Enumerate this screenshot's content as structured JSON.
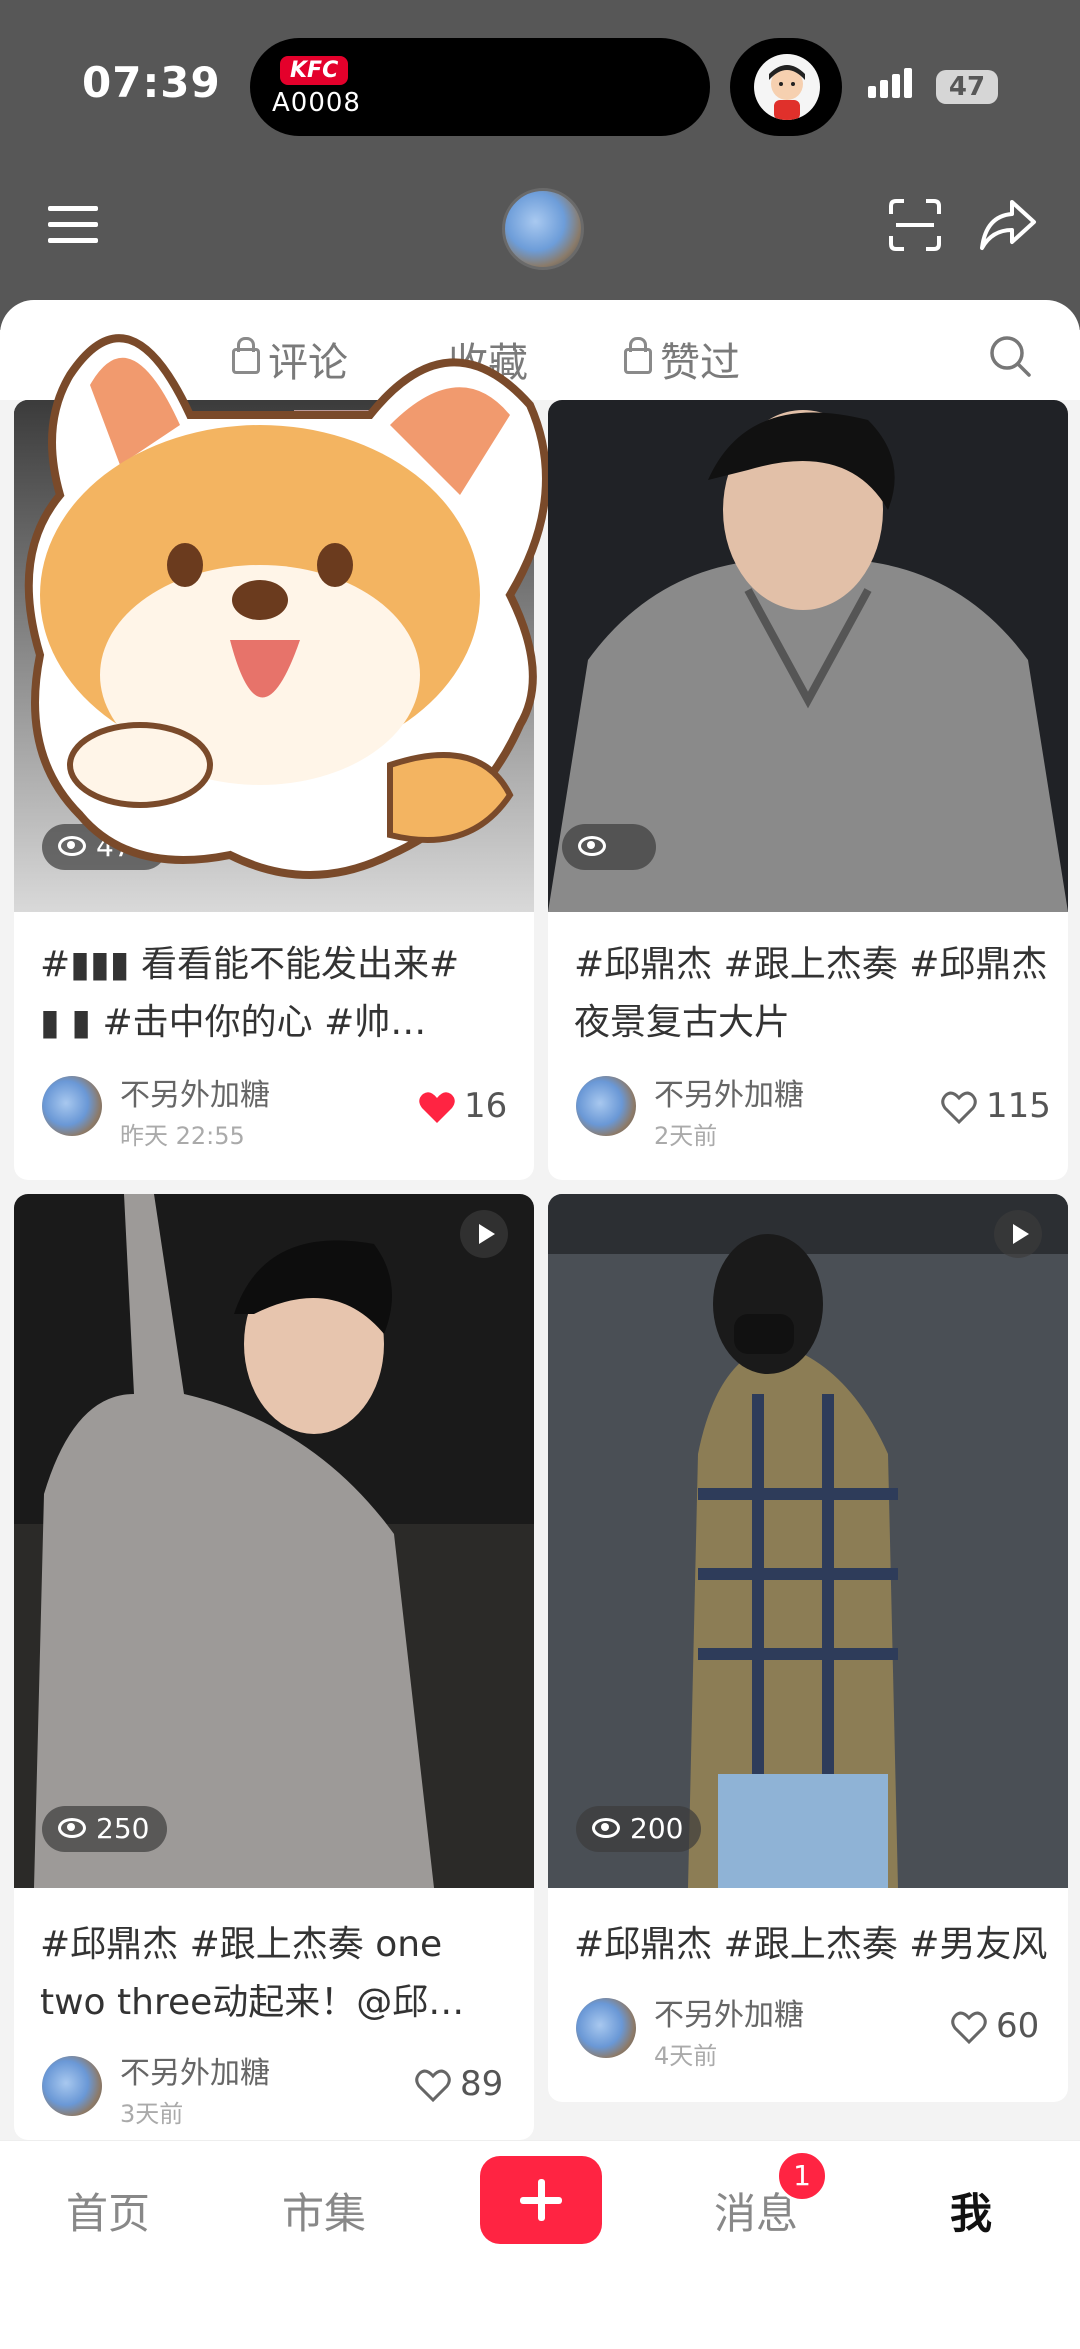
{
  "status_bar": {
    "time": "07:39",
    "island_brand": "KFC",
    "island_code": "A0008",
    "battery": "47"
  },
  "header": {
    "menu_icon": "menu-icon",
    "scan_icon": "scan-icon",
    "share_icon": "share-icon"
  },
  "tabs": [
    {
      "label": "评论",
      "locked": true
    },
    {
      "label": "收藏",
      "locked": false
    },
    {
      "label": "赞过",
      "locked": true
    }
  ],
  "posts": [
    {
      "views": "475",
      "title_line1": "#▮▮▮ 看看能不能发出来#",
      "title_line2": "▮ ▮ #击中你的心 #帅…",
      "author": "不另外加糖",
      "time": "昨天 22:55",
      "likes": "16",
      "liked": true
    },
    {
      "views": "",
      "title_line1": "#邱鼎杰 #跟上杰奏 #邱鼎杰",
      "title_line2": "夜景复古大片",
      "author": "不另外加糖",
      "time": "2天前",
      "likes": "115",
      "liked": false
    },
    {
      "views": "250",
      "title_line1": "#邱鼎杰 #跟上杰奏 one",
      "title_line2": "two three动起来！@邱…",
      "author": "不另外加糖",
      "time": "3天前",
      "likes": "89",
      "liked": false,
      "video": true
    },
    {
      "views": "200",
      "title_line1": "#邱鼎杰 #跟上杰奏 #男友风",
      "title_line2": "",
      "author": "不另外加糖",
      "time": "4天前",
      "likes": "60",
      "liked": false,
      "video": true
    }
  ],
  "bottom_nav": {
    "home": "首页",
    "market": "市集",
    "messages": "消息",
    "messages_badge": "1",
    "me": "我"
  },
  "colors": {
    "accent": "#ff2442",
    "header_bg": "#575757"
  }
}
